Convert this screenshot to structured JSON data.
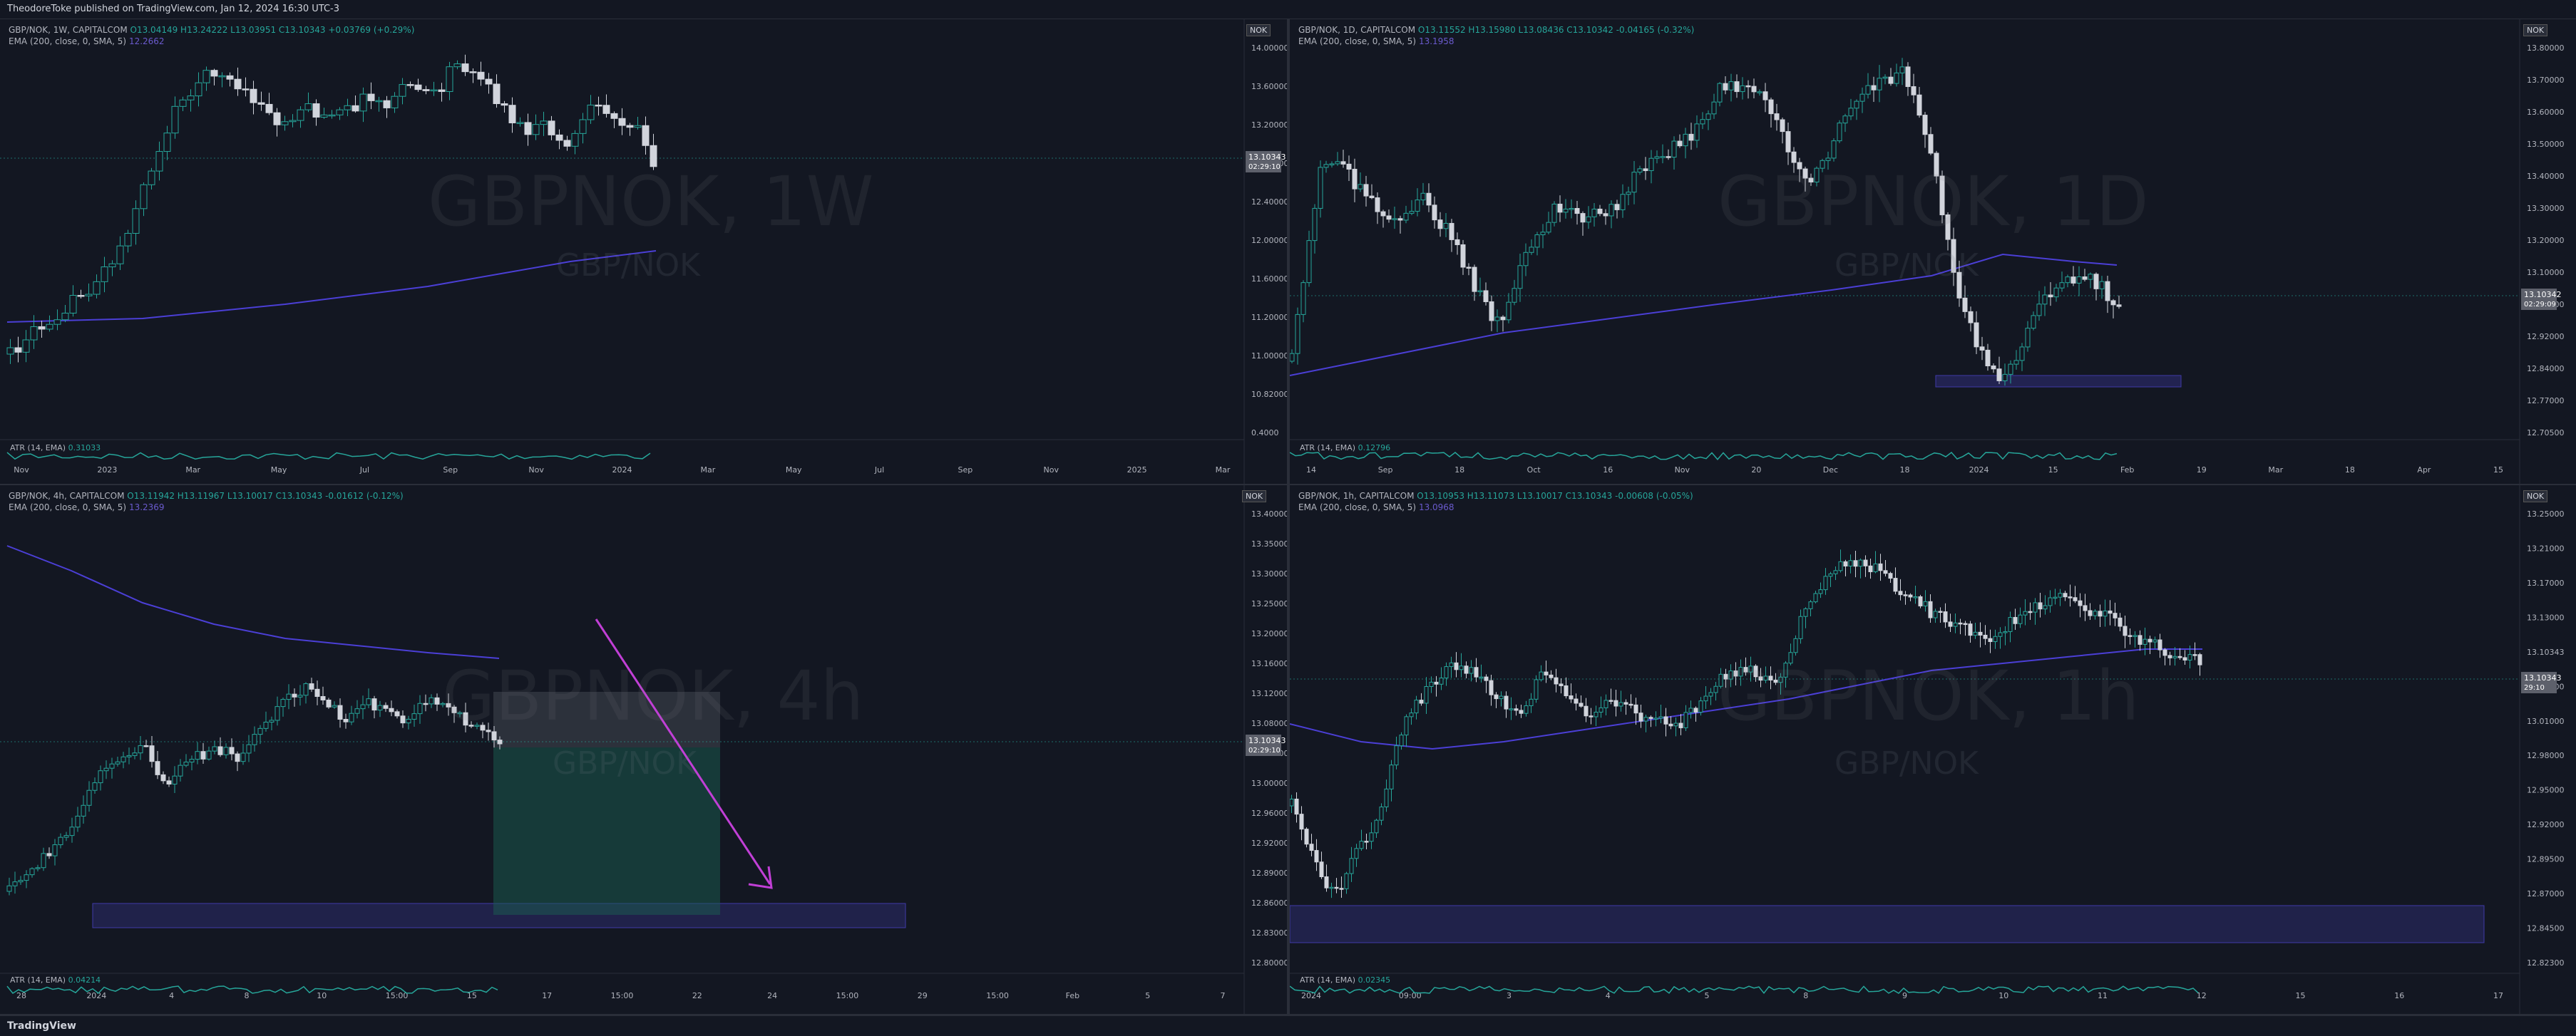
{
  "publisher": "TheodoreToke published on TradingView.com, Jan 12, 2024 16:30 UTC-3",
  "brand": "TradingView",
  "panels": [
    {
      "id": "1w",
      "header": {
        "ohlc_prefix": "GBP/NOK, 1W, CAPITALCOM",
        "ohlc": "O13.04149 H13.24222 L13.03951 C13.10343 +0.03769 (+0.29%)",
        "ema": "EMA (200, close, 0, SMA, 5)",
        "ema_val": "12.2662"
      },
      "watermark": "GBPNOK, 1W",
      "sub": "GBP/NOK",
      "currency": "NOK",
      "prices": [
        "14.00000",
        "13.60000",
        "13.20000",
        "12.80000",
        "12.40000",
        "12.00000",
        "11.60000",
        "11.20000",
        "11.00000",
        "10.82000",
        "0.4000"
      ],
      "last_price": "13.10343",
      "countdown": "02:29:10",
      "atr": "ATR (14, EMA)",
      "atr_val": "0.31033",
      "times": [
        "Nov",
        "2023",
        "Mar",
        "May",
        "Jul",
        "Sep",
        "Nov",
        "2024",
        "Mar",
        "May",
        "Jul",
        "Sep",
        "Nov",
        "2025",
        "Mar"
      ]
    },
    {
      "id": "1d",
      "header": {
        "ohlc_prefix": "GBP/NOK, 1D, CAPITALCOM",
        "ohlc": "O13.11552 H13.15980 L13.08436 C13.10342 -0.04165 (-0.32%)",
        "ema": "EMA (200, close, 0, SMA, 5)",
        "ema_val": "13.1958"
      },
      "watermark": "GBPNOK, 1D",
      "sub": "GBP/NOK",
      "currency": "NOK",
      "prices": [
        "13.80000",
        "13.70000",
        "13.60000",
        "13.50000",
        "13.40000",
        "13.30000",
        "13.20000",
        "13.10000",
        "13.00000",
        "12.92000",
        "12.84000",
        "12.77000",
        "12.70500"
      ],
      "last_price": "13.10342",
      "countdown": "02:29:09",
      "atr": "ATR (14, EMA)",
      "atr_val": "0.12796",
      "times": [
        "14",
        "Sep",
        "18",
        "Oct",
        "16",
        "Nov",
        "20",
        "Dec",
        "18",
        "2024",
        "15",
        "Feb",
        "19",
        "Mar",
        "18",
        "Apr",
        "15"
      ]
    },
    {
      "id": "4h",
      "header": {
        "ohlc_prefix": "GBP/NOK, 4h, CAPITALCOM",
        "ohlc": "O13.11942 H13.11967 L13.10017 C13.10343 -0.01612 (-0.12%)",
        "ema": "EMA (200, close, 0, SMA, 5)",
        "ema_val": "13.2369"
      },
      "watermark": "GBPNOK, 4h",
      "sub": "GBP/NOK",
      "currency": "NOK",
      "prices": [
        "13.40000",
        "13.35000",
        "13.30000",
        "13.25000",
        "13.20000",
        "13.16000",
        "13.12000",
        "13.08000",
        "13.04000",
        "13.00000",
        "12.96000",
        "12.92000",
        "12.89000",
        "12.86000",
        "12.83000",
        "12.80000"
      ],
      "last_price": "13.10343",
      "countdown": "02:29:10",
      "atr": "ATR (14, EMA)",
      "atr_val": "0.04214",
      "times": [
        "28",
        "2024",
        "4",
        "8",
        "10",
        "15:00",
        "15",
        "17",
        "15:00",
        "22",
        "24",
        "15:00",
        "29",
        "15:00",
        "Feb",
        "5",
        "7"
      ]
    },
    {
      "id": "1h",
      "header": {
        "ohlc_prefix": "GBP/NOK, 1h, CAPITALCOM",
        "ohlc": "O13.10953 H13.11073 L13.10017 C13.10343 -0.00608 (-0.05%)",
        "ema": "EMA (200, close, 0, SMA, 5)",
        "ema_val": "13.0968"
      },
      "watermark": "GBPNOK, 1h",
      "sub": "GBP/NOK",
      "currency": "NOK",
      "prices": [
        "13.25000",
        "13.21000",
        "13.17000",
        "13.13000",
        "13.10343",
        "13.05000",
        "13.01000",
        "12.98000",
        "12.95000",
        "12.92000",
        "12.89500",
        "12.87000",
        "12.84500",
        "12.82300"
      ],
      "last_price": "13.10343",
      "countdown": "29:10",
      "atr": "ATR (14, EMA)",
      "atr_val": "0.02345",
      "times": [
        "2024",
        "09:00",
        "3",
        "4",
        "5",
        "8",
        "9",
        "10",
        "11",
        "12",
        "15",
        "16",
        "17"
      ]
    }
  ],
  "colors": {
    "bg": "#131722",
    "up": "#26a69a",
    "down": "#d1d4dc",
    "ema": "#4b3fd6",
    "zone": "#3f3aa8",
    "arrow": "#c13fd6"
  }
}
